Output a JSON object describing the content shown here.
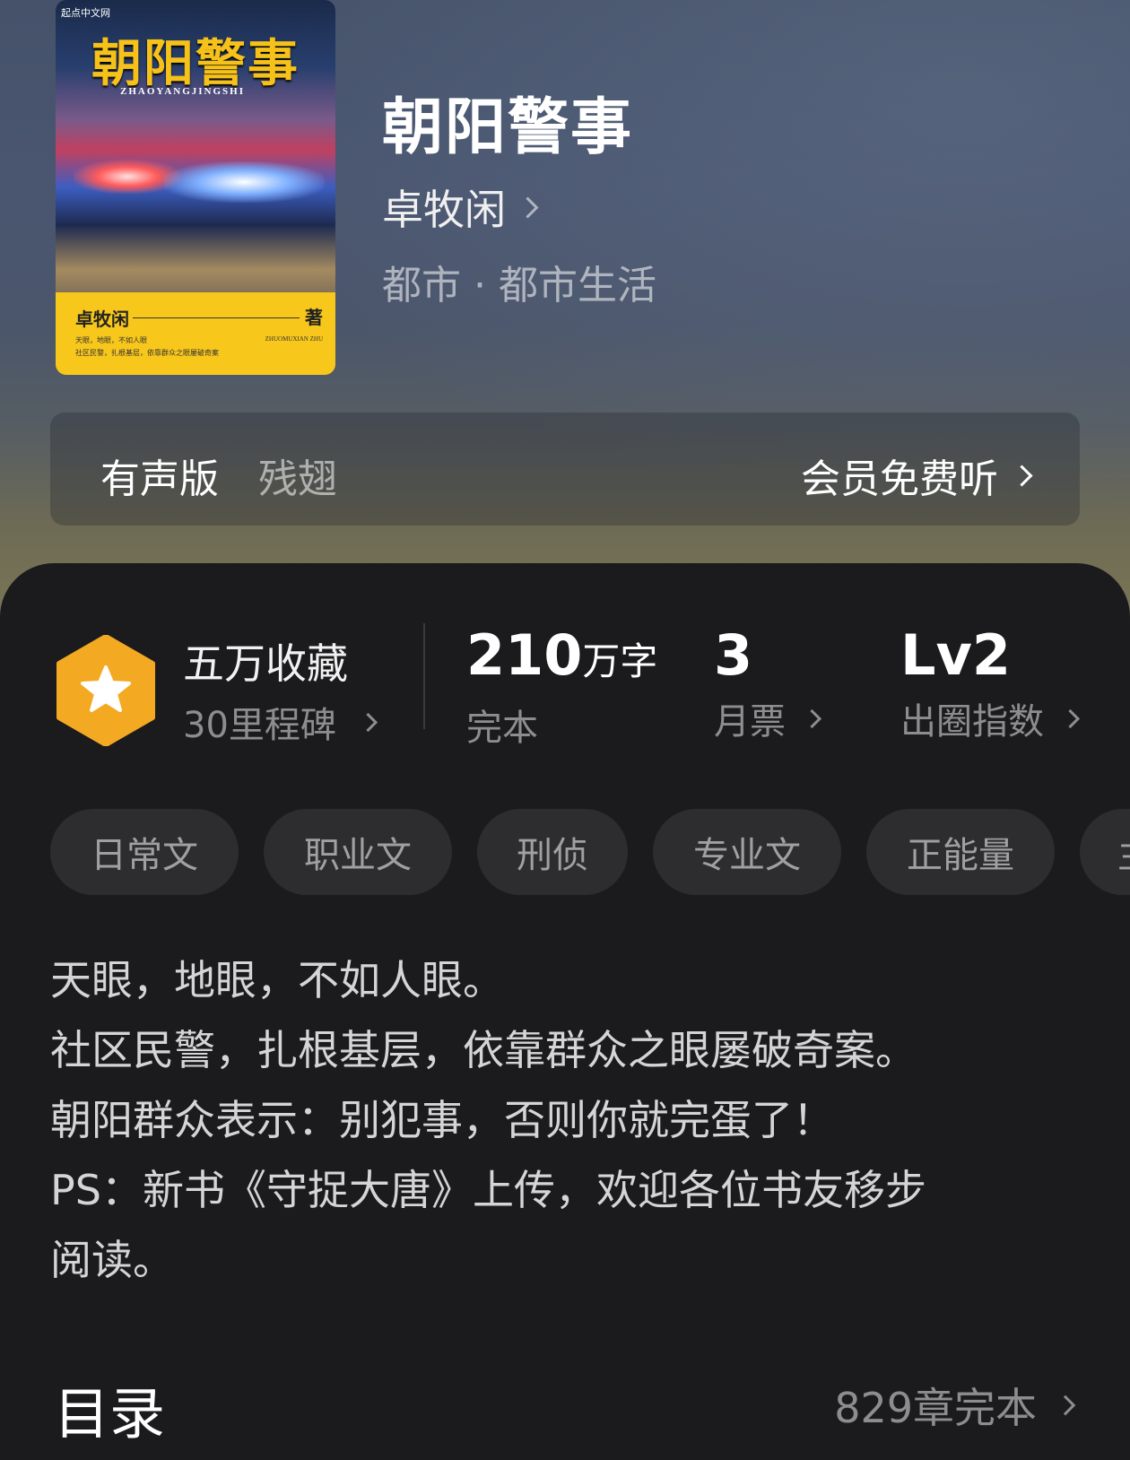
{
  "book": {
    "title": "朝阳警事",
    "author": "卓牧闲",
    "genre": "都市 · 都市生活"
  },
  "cover": {
    "logo_text": "起点中文网",
    "title": "朝阳警事",
    "pinyin": "ZHAOYANGJINGSHI",
    "author": "卓牧闲",
    "zhu": "著",
    "blurb_line1": "天眼，地眼，不如人眼",
    "blurb_line2": "社区民警，扎根基层，依靠群众之眼屡破奇案",
    "author_pinyin": "ZHUOMUXIAN ZHU"
  },
  "audio": {
    "label": "有声版",
    "narrator": "残翅",
    "action": "会员免费听"
  },
  "stats": {
    "collect_title": "五万收藏",
    "collect_sub": "30里程碑",
    "words_num": "210",
    "words_unit": "万字",
    "words_label": "完本",
    "tickets_num": "3",
    "tickets_label": "月票",
    "level_num": "Lv2",
    "level_label": "出圈指数"
  },
  "tags": [
    "日常文",
    "职业文",
    "刑侦",
    "专业文",
    "正能量",
    "主"
  ],
  "description": [
    "天眼，地眼，不如人眼。",
    "社区民警，扎根基层，依靠群众之眼屡破奇案。",
    "朝阳群众表示：别犯事，否则你就完蛋了！",
    "PS：新书《守捉大唐》上传，欢迎各位书友移步",
    "阅读。"
  ],
  "toc": {
    "title": "目录",
    "summary": "829章完本"
  },
  "colors": {
    "badge": "#f4a922",
    "sheet": "#1b1b1d",
    "tag_bg": "#2d2d30"
  }
}
